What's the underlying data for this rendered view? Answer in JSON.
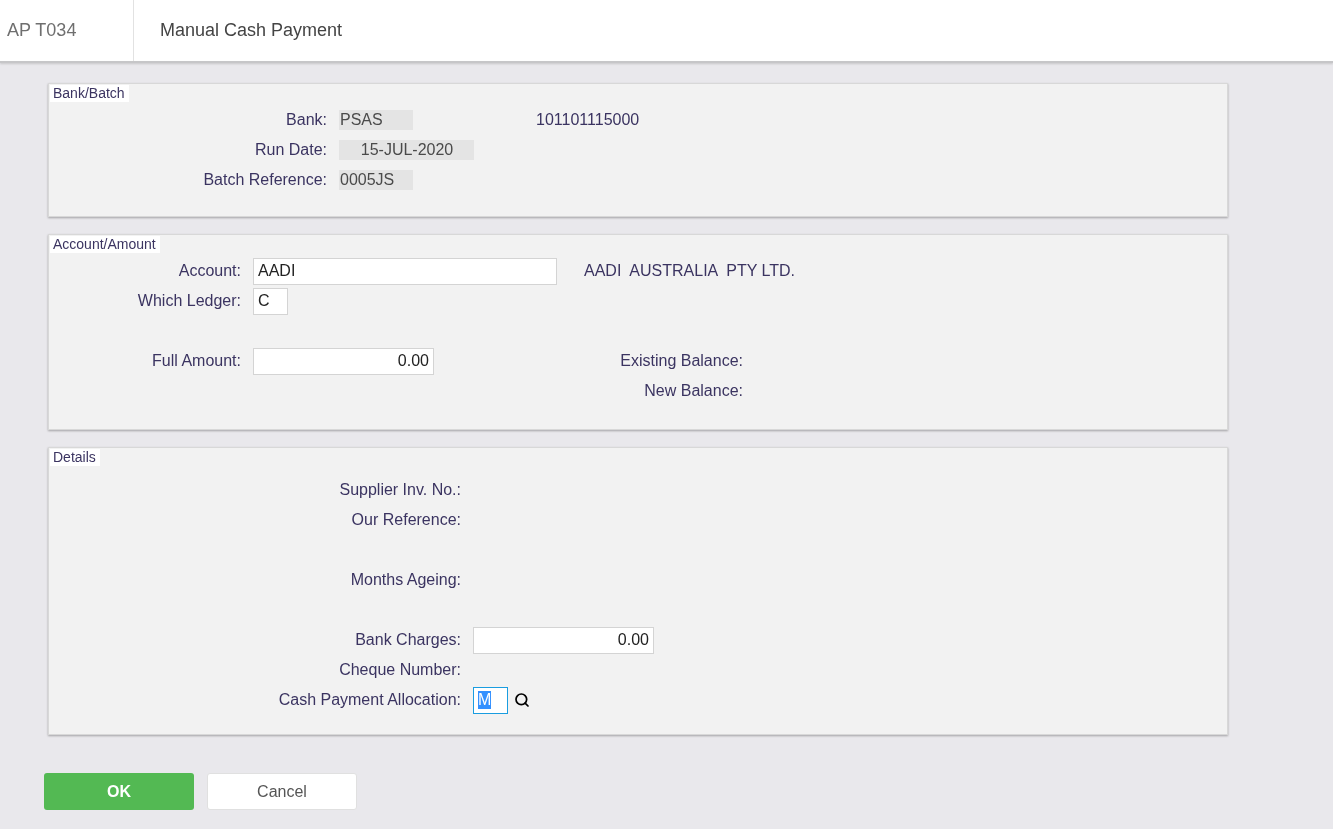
{
  "header": {
    "code": "AP T034",
    "title": "Manual Cash Payment"
  },
  "panels": [
    {
      "legend": "Bank/Batch",
      "groups": [
        [
          {
            "label": "Bank:",
            "field": {
              "kind": "code",
              "readonly": true,
              "value": "PSAS"
            },
            "aside": {
              "kind": "text",
              "text": "101101115000"
            }
          },
          {
            "label": "Run Date:",
            "field": {
              "kind": "date",
              "readonly": true,
              "value": "15-JUL-2020"
            }
          },
          {
            "label": "Batch Reference:",
            "field": {
              "kind": "code",
              "readonly": true,
              "value": "0005JS"
            }
          }
        ]
      ]
    },
    {
      "legend": "Account/Amount",
      "groups": [
        [
          {
            "label": "Account:",
            "field": {
              "kind": "name",
              "readonly": false,
              "value": "AADI"
            },
            "aside": {
              "kind": "text",
              "text": "AADI  AUSTRALIA  PTY LTD."
            }
          },
          {
            "label": "Which Ledger:",
            "field": {
              "kind": "flag",
              "readonly": false,
              "value": "C"
            }
          }
        ],
        [
          {
            "label": "Full Amount:",
            "field": {
              "kind": "amount",
              "readonly": false,
              "value": "0.00"
            },
            "aside": {
              "kind": "label",
              "text": "Existing Balance:"
            }
          },
          {
            "aside": {
              "kind": "label",
              "text": "New Balance:"
            }
          }
        ]
      ]
    },
    {
      "legend": "Details",
      "groups": [
        [
          {
            "label": "Supplier Inv. No.:"
          },
          {
            "label": "Our Reference:"
          }
        ],
        [
          {
            "label": "Months Ageing:"
          }
        ],
        [
          {
            "label": "Bank Charges:",
            "field": {
              "kind": "amount",
              "readonly": false,
              "value": "0.00"
            }
          },
          {
            "label": "Cheque Number:"
          },
          {
            "label": "Cash Payment Allocation:",
            "field": {
              "kind": "flag",
              "readonly": false,
              "focused": true,
              "value": "M",
              "lookup": true
            }
          }
        ]
      ]
    }
  ],
  "buttons": [
    {
      "label": "OK",
      "kind": "primary"
    },
    {
      "label": "Cancel",
      "kind": "secondary"
    }
  ]
}
